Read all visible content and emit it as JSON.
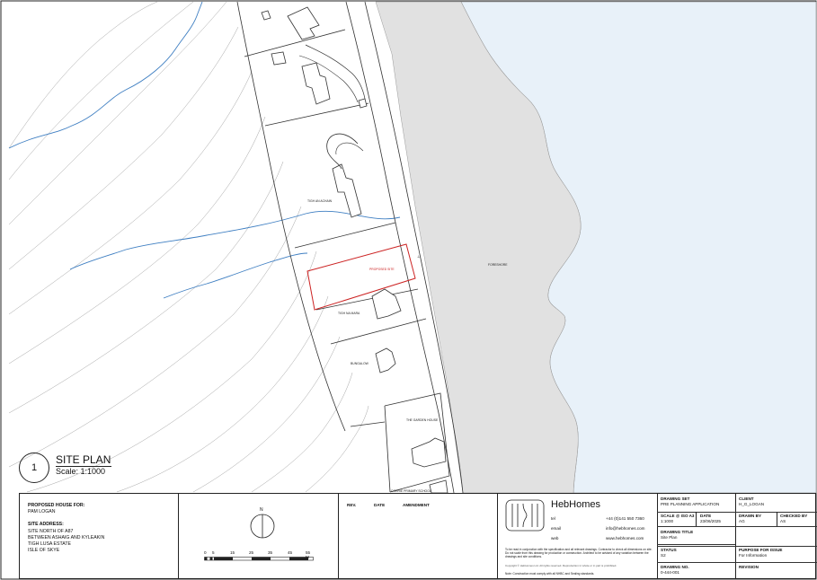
{
  "site_plan": {
    "number": "1",
    "title": "SITE PLAN",
    "scale": "Scale: 1:1000"
  },
  "map_labels": {
    "tigh_an_acham": "TIGH AN ACHAIN",
    "proposed_site": "PROPOSED SITE",
    "tigh_na_mara": "TIGH NA MARA",
    "bungalow": "BUNGALOW",
    "the_garden_house": "THE GARDEN HOUSE",
    "primary_school": "CORRIE PRIMARY SCHOOL",
    "foreshore": "FORESHORE"
  },
  "title_block": {
    "proposed_house_heading": "PROPOSED HOUSE FOR:",
    "client_name": "PAM LOGAN",
    "site_address_heading": "SITE ADDRESS:",
    "address_lines": [
      "SITE NORTH OF A87",
      "BETWEEN ASHAIG AND KYLEAKIN",
      "TIGH LUSA ESTATE",
      "ISLE OF SKYE"
    ],
    "north_label": "N",
    "scale_ticks": [
      "0",
      "5",
      "15",
      "25",
      "35",
      "45",
      "55 M"
    ],
    "rev_headers": {
      "rev": "REV.",
      "date": "DATE",
      "amendment": "AMENDMENT"
    },
    "company": {
      "name": "HebHomes",
      "tel_label": "tel",
      "tel": "+44 (0)141 550 7360",
      "email_label": "email",
      "email": "info@hebhomes.com",
      "web_label": "web",
      "web": "www.hebhomes.com",
      "disclaimer": "To be read in conjunction with the specification and all relevant drawings. Contractor to check all dimensions on site. Do not scale from this drawing for production or construction. Architect to be advised of any variation between the drawings and site conditions.",
      "copyright": "Copyright © HebHomes Ltd. All rights reserved. Reproduction in whole or in part is prohibited.",
      "note": "Note: Construction must comply with all NHBC and Sealing standards."
    },
    "drawing_set": {
      "label": "DRAWING SET",
      "value": "PRE PLANNING APPLICATION"
    },
    "client": {
      "label": "CLIENT",
      "value": "H_G_LOGAN"
    },
    "scale": {
      "label": "SCALE @ ISO A3",
      "value": "1:1000"
    },
    "date": {
      "label": "DATE",
      "value": "23/06/2025"
    },
    "drawn_by": {
      "label": "DRAWN BY",
      "value": "AG"
    },
    "checked_by": {
      "label": "CHECKED BY",
      "value": "AS"
    },
    "drawing_title": {
      "label": "DRAWING TITLE",
      "value": "Site Plan"
    },
    "status": {
      "label": "STATUS",
      "value": "S2"
    },
    "purpose": {
      "label": "PURPOSE FOR ISSUE",
      "value": "For Information"
    },
    "drawing_no": {
      "label": "DRAWING NO.",
      "value": "0-444-001"
    },
    "revision": {
      "label": "REVISION",
      "value": ""
    }
  },
  "colors": {
    "sea": "#e8f1f9",
    "foreshore": "#e0e0e0",
    "stream": "#3f7fc2",
    "boundary": "#cc2222",
    "line": "#333333"
  }
}
